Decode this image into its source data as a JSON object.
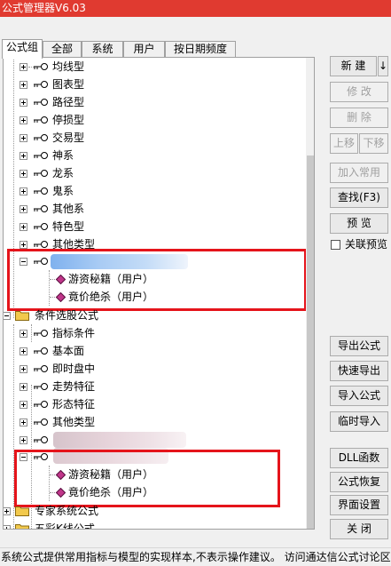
{
  "window": {
    "title": "公式管理器V6.03"
  },
  "tabs": [
    "公式组",
    "全部",
    "系统",
    "用户",
    "按日期频度"
  ],
  "tree": {
    "level1_items": [
      "均线型",
      "图表型",
      "路径型",
      "停损型",
      "交易型",
      "神系",
      "龙系",
      "鬼系",
      "其他系",
      "特色型",
      "其他类型"
    ],
    "group1_formulas": [
      "游资秘籍（用户）",
      "竟价绝杀（用户）"
    ],
    "condition_group": "条件选股公式",
    "condition_items": [
      "指标条件",
      "基本面",
      "即时盘中",
      "走势特征",
      "形态特征",
      "其他类型"
    ],
    "group2_formulas": [
      "游资秘籍（用户）",
      "竟价绝杀（用户）"
    ],
    "expert_group": "专家系统公式",
    "kline_group": "五彩K线公式"
  },
  "buttons": {
    "new": "新 建",
    "new_dropdown": "↓",
    "modify": "修 改",
    "delete": "删 除",
    "move_up": "上移",
    "move_down": "下移",
    "add_common": "加入常用",
    "find": "查找(F3)",
    "preview": "预 览",
    "link_preview": "关联预览",
    "export": "导出公式",
    "quick_export": "快速导出",
    "import": "导入公式",
    "temp_import": "临时导入",
    "dll": "DLL函数",
    "restore": "公式恢复",
    "ui_settings": "界面设置",
    "close": "关 闭"
  },
  "status": "系统公式提供常用指标与模型的实现样本,不表示操作建议。    访问通达信公式讨论区",
  "colors": {
    "titlebar": "#e03a30",
    "highlight_box": "#e5141b",
    "folder": "#f2c94c",
    "diamond": "#c0368a"
  }
}
